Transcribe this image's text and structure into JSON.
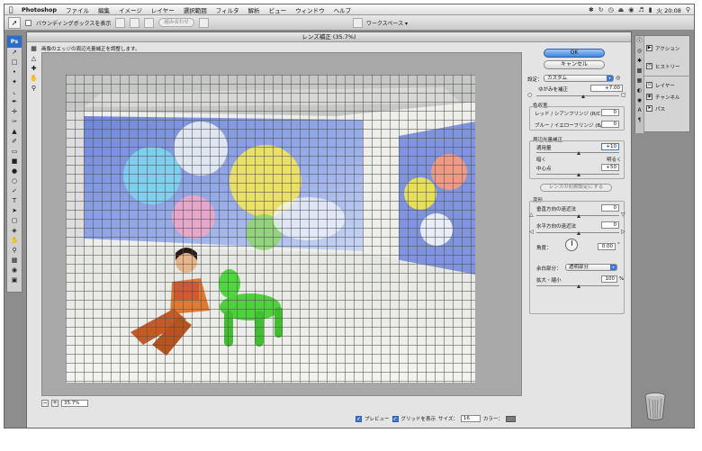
{
  "menubar": {
    "app_name": "Photoshop",
    "items": [
      "ファイル",
      "編集",
      "イメージ",
      "レイヤー",
      "選択範囲",
      "フィルタ",
      "解析",
      "ビュー",
      "ウィンドウ",
      "ヘルプ"
    ],
    "clock": "火 20:08"
  },
  "optionsbar": {
    "bounding_box_label": "バウンディングボックスを表示",
    "combine_button": "組み合わせ",
    "workspace_label": "ワークスペース ▾"
  },
  "tools": {
    "ps_label": "Ps"
  },
  "dialog": {
    "title": "レンズ補正 (35.7%)",
    "hint": "画像のエッジの周辺光量補正を調整します。",
    "zoom_value": "35.7%",
    "ok_label": "OK",
    "cancel_label": "キャンセル",
    "settings": {
      "preset_label": "設定：",
      "preset_value": "カスタム",
      "distortion_label": "ゆがみを補正",
      "distortion_value": "+7.00",
      "chromatic_section": "色収差",
      "red_cyan_label": "レッド / シアンフリンジ (R/C)",
      "red_cyan_value": "0",
      "blue_yellow_label": "ブルー / イエローフリンジ (B/Y)",
      "blue_yellow_value": "0",
      "vignette_section": "周辺光量補正",
      "amount_label": "適用量",
      "amount_value": "+10",
      "darken_label": "暗く",
      "lighten_label": "明るく",
      "midpoint_label": "中心点",
      "midpoint_value": "+50",
      "set_default_button": "レンズの初期設定にする",
      "transform_section": "変形",
      "vertical_label": "垂直方向の遠近法",
      "vertical_value": "0",
      "horizontal_label": "水平方向の遠近法",
      "horizontal_value": "0",
      "angle_label": "角度：",
      "angle_value": "0.00",
      "angle_unit": "°",
      "edge_label": "余白部分：",
      "edge_value": "透明部分",
      "scale_label": "拡大・縮小",
      "scale_value": "100",
      "scale_unit": "%"
    },
    "bottom": {
      "preview_label": "プレビュー",
      "grid_label": "グリッドを表示",
      "size_label": "サイズ：",
      "size_value": "16",
      "color_label": "カラー："
    }
  },
  "dock": {
    "items": [
      "アクション",
      "ヒストリー",
      "レイヤー",
      "チャンネル",
      "パス"
    ]
  },
  "colors": {
    "accent": "#3b78d8",
    "ok_button": "#5b9ff0",
    "grid_color": "#505050",
    "desktop_gray": "#8d8d8d"
  }
}
